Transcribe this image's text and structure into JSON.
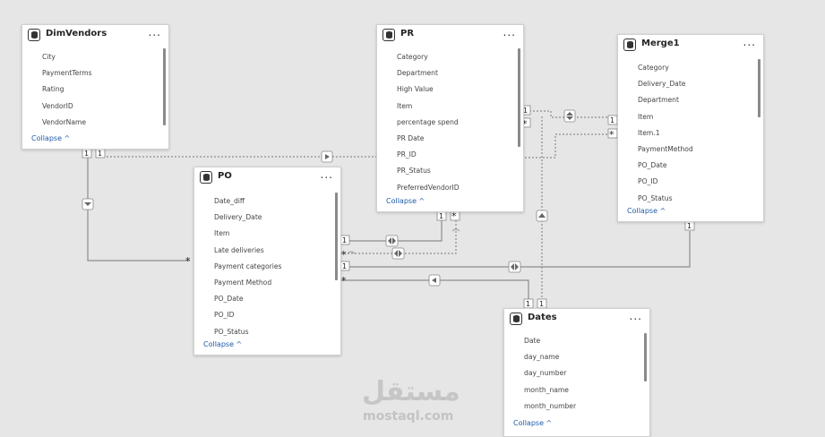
{
  "tables": {
    "dimvendors": {
      "title": "DimVendors",
      "fields": [
        "City",
        "PaymentTerms",
        "Rating",
        "VendorID",
        "VendorName"
      ],
      "collapse_label": "Collapse"
    },
    "pr": {
      "title": "PR",
      "fields": [
        "Category",
        "Department",
        "High Value",
        "Item",
        "percentage spend",
        "PR Date",
        "PR_ID",
        "PR_Status",
        "PreferredVendorID"
      ],
      "collapse_label": "Collapse"
    },
    "merge1": {
      "title": "Merge1",
      "fields": [
        "Category",
        "Delivery_Date",
        "Department",
        "Item",
        "Item.1",
        "PaymentMethod",
        "PO_Date",
        "PO_ID",
        "PO_Status"
      ],
      "collapse_label": "Collapse"
    },
    "po": {
      "title": "PO",
      "fields": [
        "Date_diff",
        "Delivery_Date",
        "Item",
        "Late deliveries",
        "Payment categories",
        "Payment Method",
        "PO_Date",
        "PO_ID",
        "PO_Status"
      ],
      "collapse_label": "Collapse"
    },
    "dates": {
      "title": "Dates",
      "fields": [
        "Date",
        "day_name",
        "day_number",
        "month_name",
        "month_number"
      ],
      "collapse_label": "Collapse"
    }
  },
  "more_label": "...",
  "collapse_chevron": "^",
  "cardinality": {
    "one": "1",
    "many": "*"
  },
  "watermark": {
    "arabic": "مستقل",
    "latin": "mostaql.com"
  },
  "colors": {
    "canvas": "#e6e6e6",
    "card": "#ffffff",
    "line": "#8c8c8c",
    "collapse_link": "#1f5ca8"
  }
}
